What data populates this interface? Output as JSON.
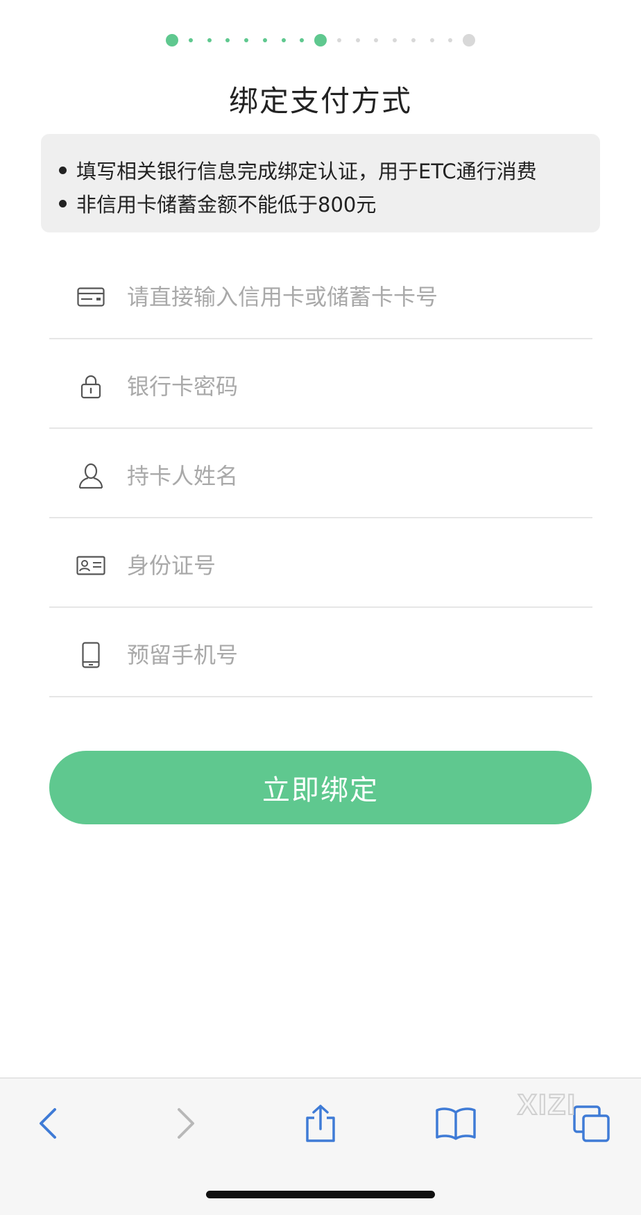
{
  "progress": {
    "value": 0.5
  },
  "page_title": "绑定支付方式",
  "notice": {
    "items": [
      "填写相关银行信息完成绑定认证，用于ETC通行消费",
      "非信用卡储蓄金额不能低于800元"
    ]
  },
  "form": {
    "fields": [
      {
        "icon": "bank-card-icon",
        "placeholder": "请直接输入信用卡或储蓄卡卡号",
        "value": ""
      },
      {
        "icon": "lock-icon",
        "placeholder": "银行卡密码",
        "value": ""
      },
      {
        "icon": "person-icon",
        "placeholder": "持卡人姓名",
        "value": ""
      },
      {
        "icon": "id-card-icon",
        "placeholder": "身份证号",
        "value": ""
      },
      {
        "icon": "mobile-phone-icon",
        "placeholder": "预留手机号",
        "value": ""
      }
    ],
    "submit_label": "立即绑定"
  },
  "toolbar": {
    "icons": [
      "back-icon",
      "forward-icon",
      "share-icon",
      "bookmarks-icon",
      "tabs-icon"
    ]
  },
  "watermark": {
    "text": "XIZI"
  },
  "colors": {
    "accent": "#5fc88f",
    "pending": "#d8d8d8",
    "notice_bg": "#efefef",
    "placeholder": "#a9a9a9",
    "toolbar_icon": "#3f7bd6",
    "toolbar_icon_disabled": "#b8b8b8"
  }
}
